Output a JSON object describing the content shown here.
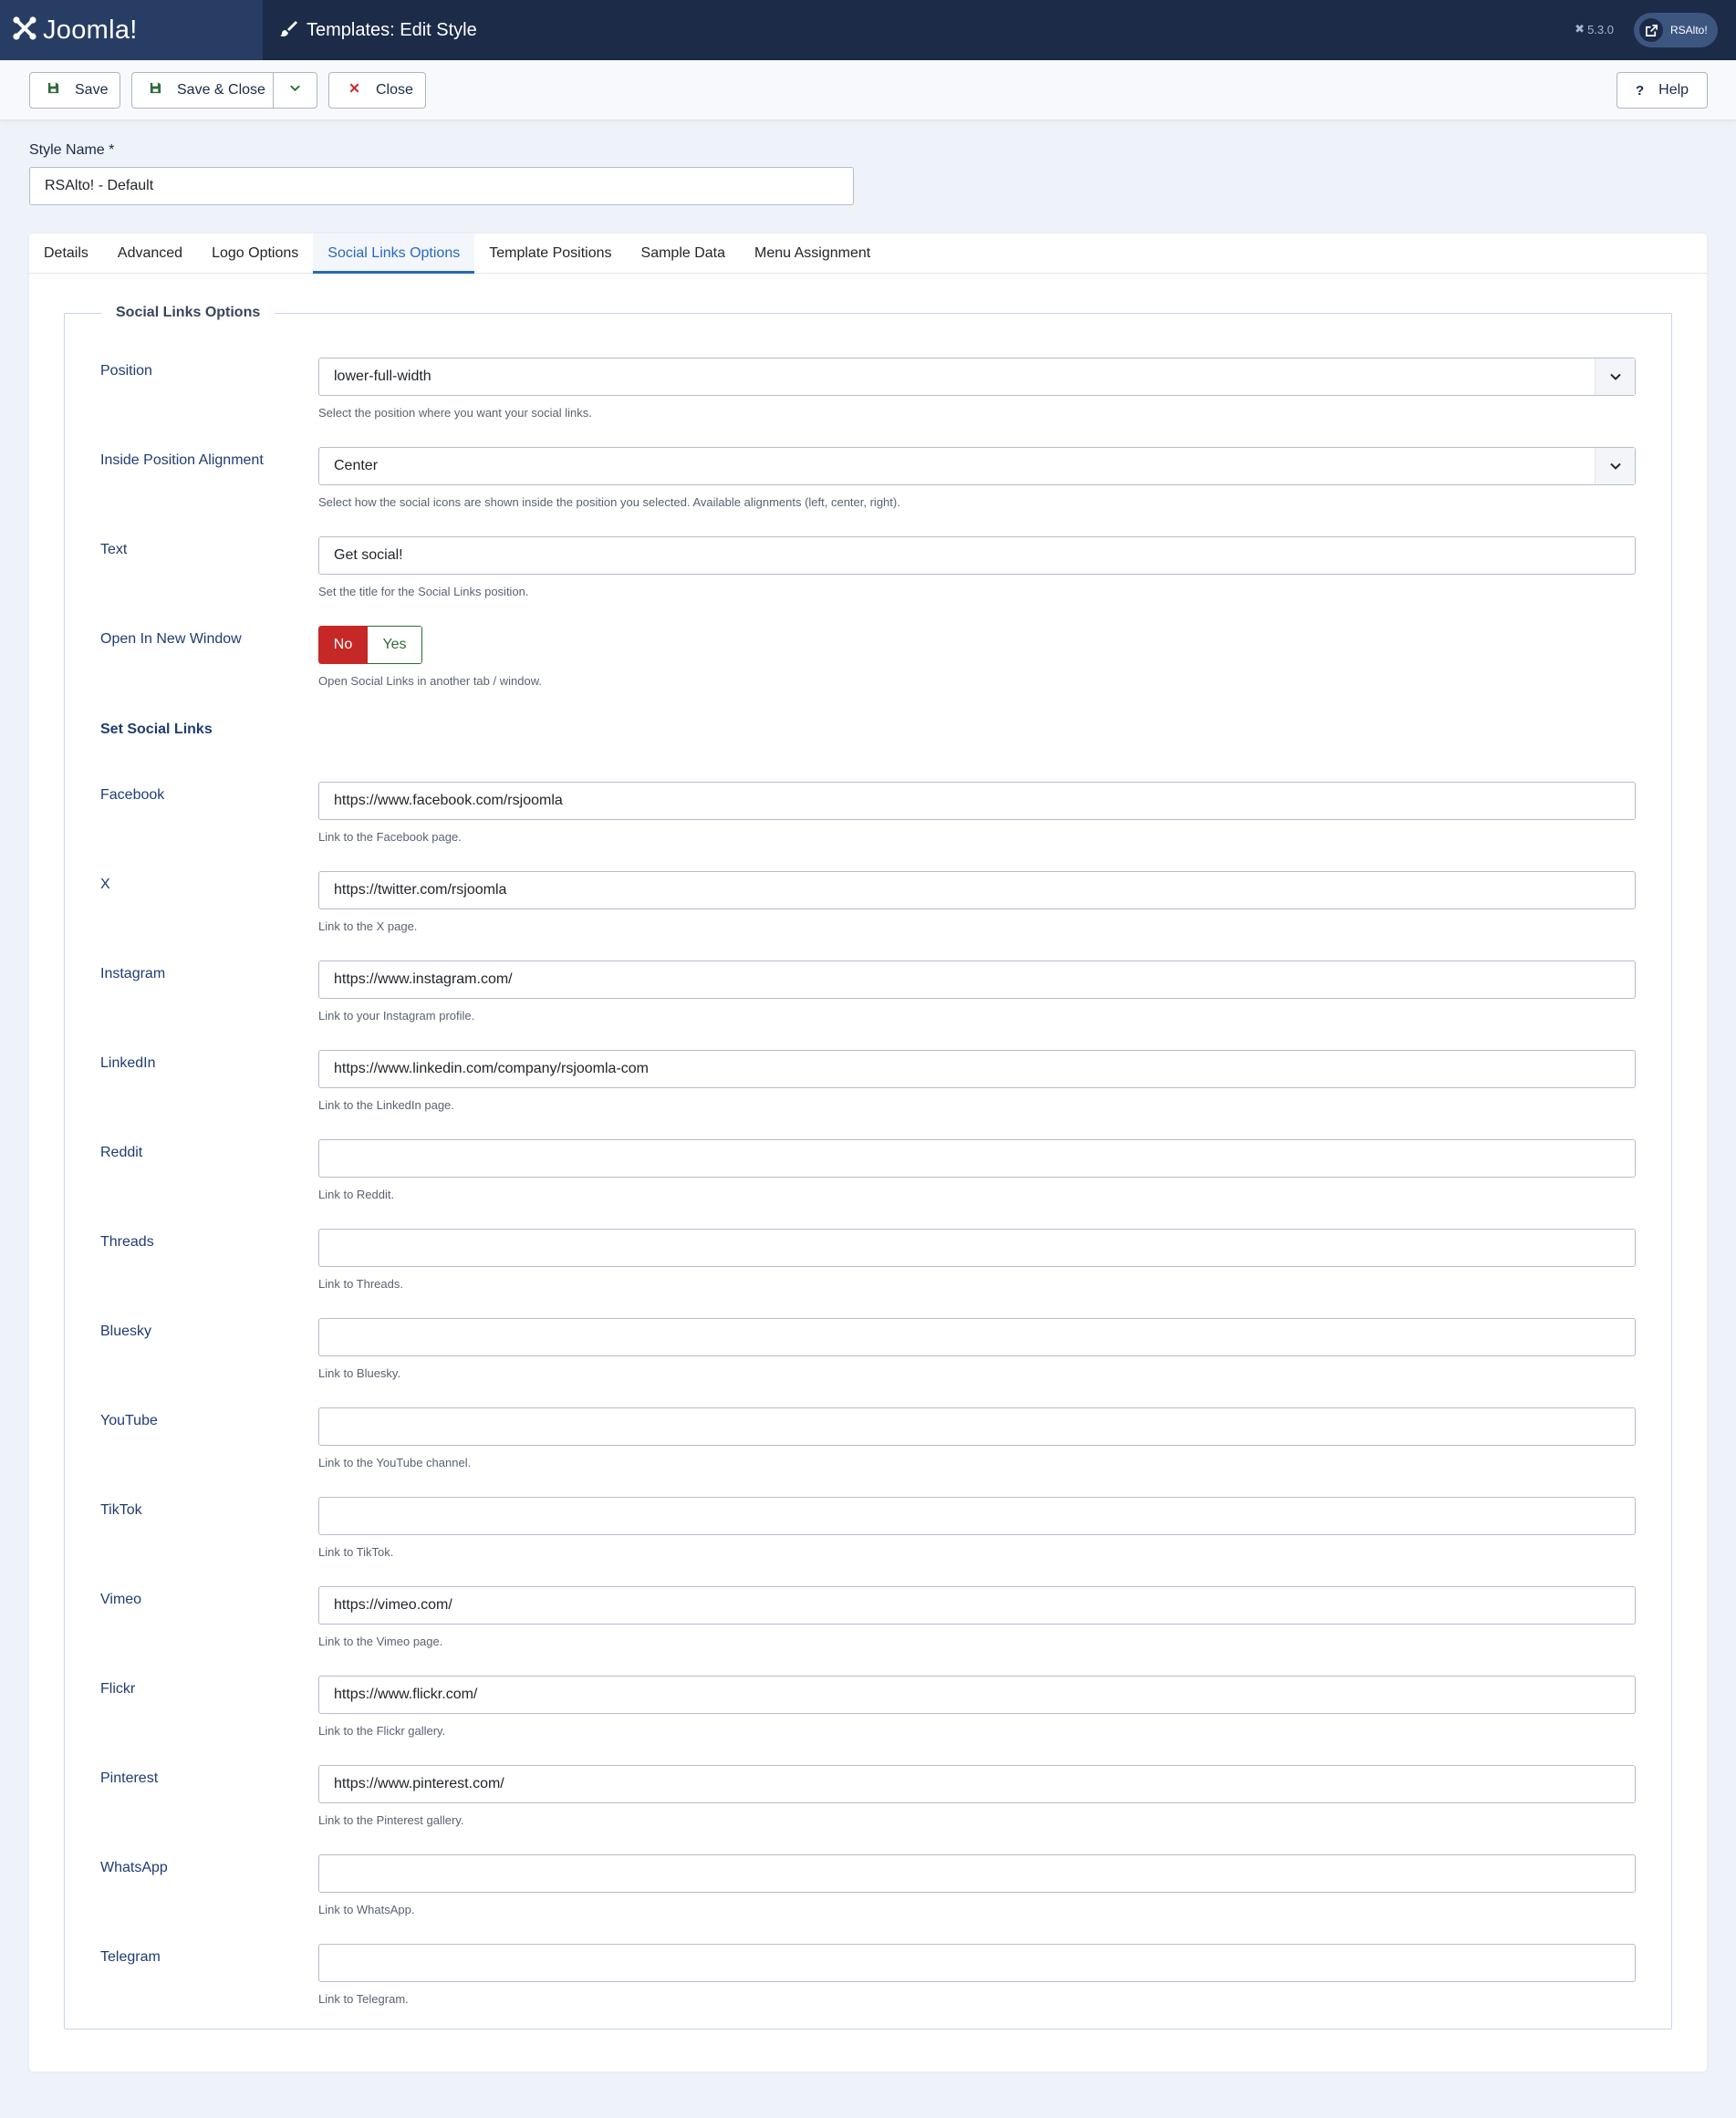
{
  "header": {
    "brand": "Joomla!",
    "title": "Templates: Edit Style",
    "version": "5.3.0",
    "user": "RSAlto!"
  },
  "toolbar": {
    "save": "Save",
    "save_close": "Save & Close",
    "close": "Close",
    "help": "Help"
  },
  "style_name": {
    "label": "Style Name *",
    "value": "RSAlto! - Default"
  },
  "tabs": [
    "Details",
    "Advanced",
    "Logo Options",
    "Social Links Options",
    "Template Positions",
    "Sample Data",
    "Menu Assignment"
  ],
  "active_tab": "Social Links Options",
  "fieldset": {
    "legend": "Social Links Options",
    "position": {
      "label": "Position",
      "value": "lower-full-width",
      "help": "Select the position where you want your social links."
    },
    "alignment": {
      "label": "Inside Position Alignment",
      "value": "Center",
      "help": "Select how the social icons are shown inside the position you selected. Available alignments (left, center, right)."
    },
    "text": {
      "label": "Text",
      "value": "Get social!",
      "help": "Set the title for the Social Links position."
    },
    "new_window": {
      "label": "Open In New Window",
      "no": "No",
      "yes": "Yes",
      "selected": "No",
      "help": "Open Social Links in another tab / window."
    },
    "subheading": "Set Social Links",
    "links": [
      {
        "label": "Facebook",
        "value": "https://www.facebook.com/rsjoomla",
        "help": "Link to the Facebook page."
      },
      {
        "label": "X",
        "value": "https://twitter.com/rsjoomla",
        "help": "Link to the X page."
      },
      {
        "label": "Instagram",
        "value": "https://www.instagram.com/",
        "help": "Link to your Instagram profile."
      },
      {
        "label": "LinkedIn",
        "value": "https://www.linkedin.com/company/rsjoomla-com",
        "help": "Link to the LinkedIn page."
      },
      {
        "label": "Reddit",
        "value": "",
        "help": "Link to Reddit."
      },
      {
        "label": "Threads",
        "value": "",
        "help": "Link to Threads."
      },
      {
        "label": "Bluesky",
        "value": "",
        "help": "Link to Bluesky."
      },
      {
        "label": "YouTube",
        "value": "",
        "help": "Link to the YouTube channel."
      },
      {
        "label": "TikTok",
        "value": "",
        "help": "Link to TikTok."
      },
      {
        "label": "Vimeo",
        "value": "https://vimeo.com/",
        "help": "Link to the Vimeo page."
      },
      {
        "label": "Flickr",
        "value": "https://www.flickr.com/",
        "help": "Link to the Flickr gallery."
      },
      {
        "label": "Pinterest",
        "value": "https://www.pinterest.com/",
        "help": "Link to the Pinterest gallery."
      },
      {
        "label": "WhatsApp",
        "value": "",
        "help": "Link to WhatsApp."
      },
      {
        "label": "Telegram",
        "value": "",
        "help": "Link to Telegram."
      }
    ]
  },
  "colors": {
    "header_bg": "#1c2b48",
    "accent": "#2a69b8",
    "toggle_no": "#c52827",
    "toggle_yes": "#2f6b39"
  }
}
